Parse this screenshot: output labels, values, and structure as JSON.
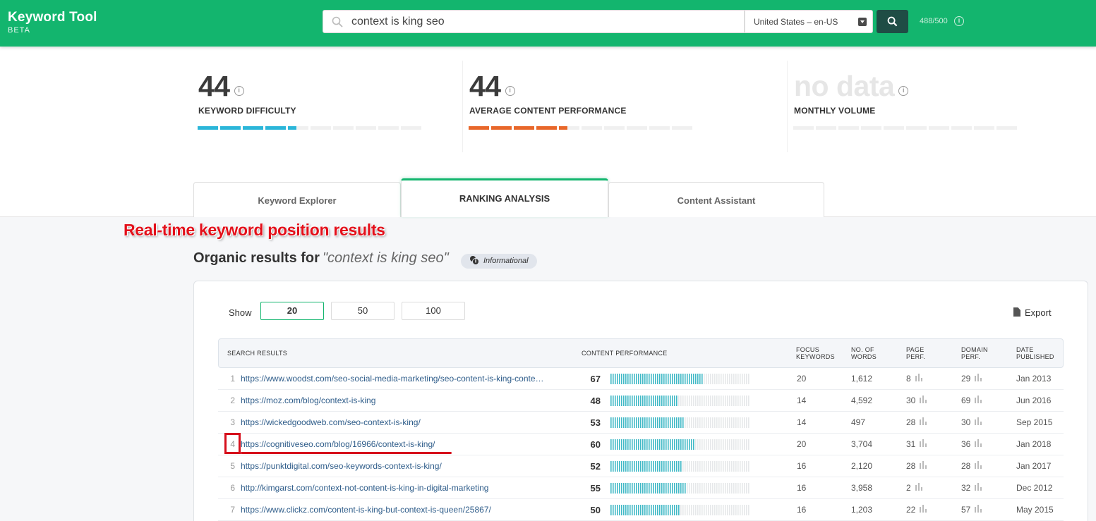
{
  "header": {
    "brand_name": "Keyword Tool",
    "brand_sub": "BETA",
    "search_value": "context is king seo",
    "locale": "United States – en-US",
    "credits": "488/500",
    "accent": "#13b56e"
  },
  "metrics": [
    {
      "value": "44",
      "label": "KEYWORD DIFFICULTY",
      "color": "#2bb6d9",
      "fraction": 0.44
    },
    {
      "value": "44",
      "label": "AVERAGE CONTENT PERFORMANCE",
      "color": "#e8672a",
      "fraction": 0.44
    },
    {
      "value": "no data",
      "label": "MONTHLY VOLUME",
      "color": "#eeeeee",
      "fraction": 0
    }
  ],
  "tabs": {
    "keyword_explorer": "Keyword Explorer",
    "ranking_analysis": "RANKING ANALYSIS",
    "content_assistant": "Content Assistant"
  },
  "annotation": "Real-time keyword position results",
  "results": {
    "title_prefix": "Organic results for",
    "query": "\"context is king seo\"",
    "intent": "Informational",
    "show_label": "Show",
    "page_sizes": [
      "20",
      "50",
      "100"
    ],
    "selected_page_size": "20",
    "export_label": "Export",
    "columns": {
      "search_results": "SEARCH RESULTS",
      "content_performance": "CONTENT PERFORMANCE",
      "focus_keywords_1": "FOCUS",
      "focus_keywords_2": "KEYWORDS",
      "words_1": "NO. OF",
      "words_2": "WORDS",
      "page_perf_1": "PAGE",
      "page_perf_2": "PERF.",
      "domain_perf_1": "DOMAIN",
      "domain_perf_2": "PERF.",
      "date_1": "DATE",
      "date_2": "PUBLISHED"
    },
    "rows": [
      {
        "rank": "1",
        "url": "https://www.woodst.com/seo-social-media-marketing/seo-content-is-king-conte…",
        "cp": "67",
        "fk": "20",
        "words": "1,612",
        "page_perf": "8",
        "domain_perf": "29",
        "date": "Jan 2013"
      },
      {
        "rank": "2",
        "url": "https://moz.com/blog/context-is-king",
        "cp": "48",
        "fk": "14",
        "words": "4,592",
        "page_perf": "30",
        "domain_perf": "69",
        "date": "Jun 2016"
      },
      {
        "rank": "3",
        "url": "https://wickedgoodweb.com/seo-context-is-king/",
        "cp": "53",
        "fk": "14",
        "words": "497",
        "page_perf": "28",
        "domain_perf": "30",
        "date": "Sep 2015"
      },
      {
        "rank": "4",
        "url": "https://cognitiveseo.com/blog/16966/context-is-king/",
        "cp": "60",
        "fk": "20",
        "words": "3,704",
        "page_perf": "31",
        "domain_perf": "36",
        "date": "Jan 2018"
      },
      {
        "rank": "5",
        "url": "https://punktdigital.com/seo-keywords-context-is-king/",
        "cp": "52",
        "fk": "16",
        "words": "2,120",
        "page_perf": "28",
        "domain_perf": "28",
        "date": "Jan 2017"
      },
      {
        "rank": "6",
        "url": "http://kimgarst.com/context-not-content-is-king-in-digital-marketing",
        "cp": "55",
        "fk": "16",
        "words": "3,958",
        "page_perf": "2",
        "domain_perf": "32",
        "date": "Dec 2012"
      },
      {
        "rank": "7",
        "url": "https://www.clickz.com/content-is-king-but-context-is-queen/25867/",
        "cp": "50",
        "fk": "16",
        "words": "1,203",
        "page_perf": "22",
        "domain_perf": "57",
        "date": "May 2015"
      }
    ],
    "bar_color": "#41b9c6",
    "highlight_color": "#d60f1c"
  }
}
